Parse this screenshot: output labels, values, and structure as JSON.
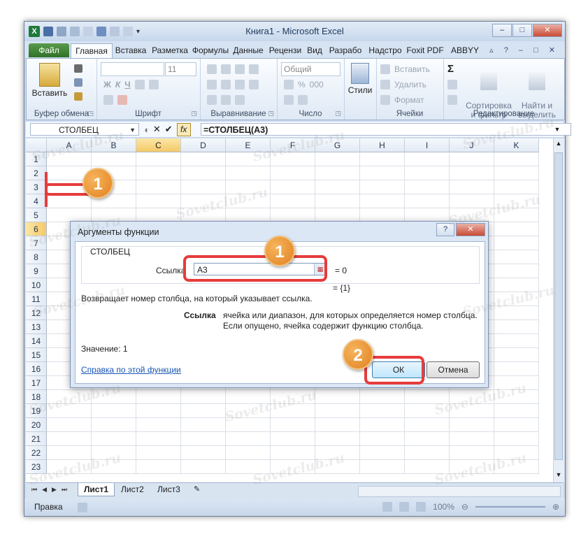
{
  "window": {
    "title": "Книга1 - Microsoft Excel",
    "controls": {
      "minimize": "–",
      "maximize": "□",
      "close": "✕"
    },
    "logo_glyph": "X"
  },
  "ribbon_tabs": [
    "Файл",
    "Главная",
    "Вставка",
    "Разметка",
    "Формулы",
    "Данные",
    "Рецензи",
    "Вид",
    "Разрабо",
    "Надстро",
    "Foxit PDF",
    "ABBYY PDF"
  ],
  "ribbon": {
    "clipboard": {
      "label": "Буфер обмена",
      "paste": "Вставить"
    },
    "font": {
      "label": "Шрифт",
      "size": "11",
      "bold": "Ж",
      "italic": "К",
      "underline": "Ч"
    },
    "alignment": {
      "label": "Выравнивание"
    },
    "number": {
      "label": "Число",
      "format": "Общий",
      "percent": "%",
      "thousands": "000"
    },
    "styles": {
      "label": "Стили"
    },
    "cells": {
      "label": "Ячейки",
      "insert": "Вставить",
      "delete": "Удалить",
      "format": "Формат"
    },
    "editing": {
      "label": "Редактирование",
      "sort": "Сортировка\nи фильтр",
      "find": "Найти и\nвыделить",
      "sigma": "Σ"
    }
  },
  "formula_bar": {
    "name_box": "СТОЛБЕЦ",
    "cancel": "✕",
    "enter": "✔",
    "fx": "fx",
    "formula": "=СТОЛБЕЦ(А3)"
  },
  "sheet": {
    "columns": [
      "A",
      "B",
      "C",
      "D",
      "E",
      "F",
      "G",
      "H",
      "I",
      "J",
      "K"
    ],
    "selected_column": "C",
    "rows": [
      "1",
      "2",
      "3",
      "4",
      "5",
      "6",
      "7",
      "8",
      "9",
      "10",
      "11",
      "12",
      "13",
      "14",
      "15",
      "16",
      "17",
      "18",
      "19",
      "20",
      "21",
      "22",
      "23"
    ],
    "selected_row": "6"
  },
  "sheet_tabs": [
    "Лист1",
    "Лист2",
    "Лист3"
  ],
  "status": {
    "ready": "Правка",
    "zoom": "100%"
  },
  "dialog": {
    "title": "Аргументы функции",
    "help_btn": "?",
    "function_name": "СТОЛБЕЦ",
    "arg_label": "Ссылка",
    "arg_value": "А3",
    "arg_result": "= 0",
    "fn_result": "= {1}",
    "description": "Возвращает номер столбца, на который указывает ссылка.",
    "arg_name": "Ссылка",
    "arg_description": "ячейка или диапазон, для которых определяется номер столбца. Если опущено, ячейка содержит функцию столбца.",
    "value_text": "Значение:  1",
    "help_link": "Справка по этой функции",
    "ok": "ОК",
    "cancel": "Отмена"
  },
  "annotations": {
    "badge1": "1",
    "badge2": "2",
    "badge3": "1",
    "accent": "#e63c3c"
  },
  "watermark": "Sovetclub.ru"
}
